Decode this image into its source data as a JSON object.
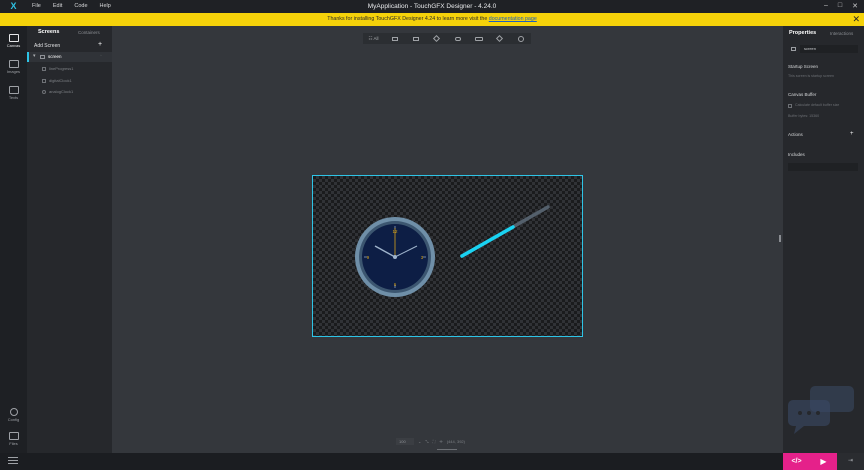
{
  "titlebar": {
    "title": "MyApplication - TouchGFX Designer - 4.24.0",
    "menu": [
      "File",
      "Edit",
      "Code",
      "Help"
    ],
    "minimize": "–",
    "maximize": "□",
    "close": "✕",
    "logo": "X"
  },
  "notice": {
    "text": "Thanks for installing TouchGFX Designer 4.24 to learn more visit the ",
    "link": "documentation page",
    "close": "✕"
  },
  "rail": {
    "items": [
      {
        "label": "Canvas",
        "icon": "canvas-icon"
      },
      {
        "label": "Images",
        "icon": "images-icon"
      },
      {
        "label": "Texts",
        "icon": "texts-icon"
      }
    ],
    "bottom": [
      {
        "label": "Config",
        "icon": "gear-icon"
      },
      {
        "label": "Files",
        "icon": "folder-icon"
      }
    ]
  },
  "screens_panel": {
    "tab_screens": "Screens",
    "tab_containers": "Containers",
    "add_screen": "Add Screen",
    "screen_name": "screen",
    "children": [
      "lineProgress1",
      "digitalClock1",
      "analogClock1"
    ]
  },
  "toolbar": {
    "all_label": "All",
    "tools": [
      "box-icon",
      "image-icon",
      "layers-icon",
      "container-icon",
      "button-icon",
      "shape-icon",
      "more-icon"
    ]
  },
  "canvas": {
    "clock_numbers": [
      "12",
      "3",
      "6",
      "9"
    ]
  },
  "zoombar": {
    "zoom": "100",
    "coords": "(444, 392)"
  },
  "properties": {
    "tab_properties": "Properties",
    "tab_interactions": "Interactions",
    "name_value": "screen",
    "startup_title": "Startup Screen",
    "startup_sub": "This screen is startup screen",
    "canvas_buffer_title": "Canvas Buffer",
    "canvas_buffer_checkbox": "Calculate default buffer size",
    "buffer_size": "Buffer bytes: 15360",
    "actions_title": "Actions",
    "includes_title": "Includes"
  },
  "bottombar": {
    "code_label": "</>",
    "run_label": "▶",
    "export_label": "⇥"
  },
  "colors": {
    "accent": "#2ec4e6",
    "notice": "#f5d20a",
    "pink": "#e5218a",
    "clock_face": "#0d1e45",
    "clock_ring": "#6f8fa8"
  }
}
